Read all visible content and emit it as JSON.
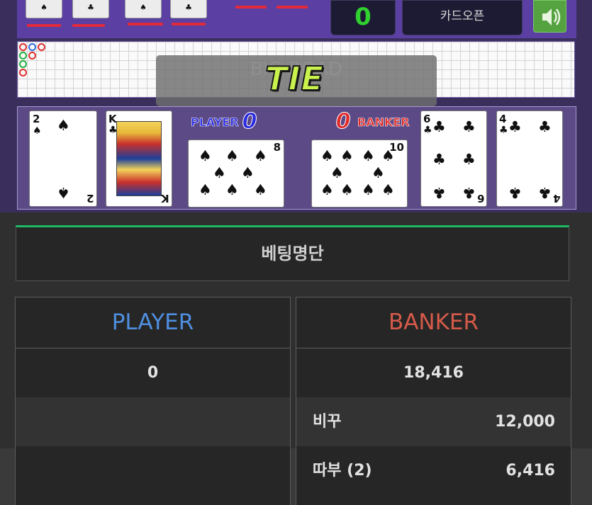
{
  "game": {
    "count_value": "0",
    "card_open_label": "카드오픈",
    "road_label": "BIG ROAD",
    "result_text": "TIE",
    "player_label": "PLAYER",
    "banker_label": "BANKER",
    "player_score": "0",
    "banker_score": "0",
    "road_dot_colors": [
      "#e03030",
      "#2f6fe0",
      "#e03030",
      "#22b040",
      "#e03030",
      "#22b040"
    ],
    "player_cards": [
      {
        "rank": "2",
        "suit": "♠"
      },
      {
        "rank": "K",
        "suit": "♣"
      },
      {
        "rank": "8",
        "suit": "♠"
      }
    ],
    "banker_cards": [
      {
        "rank": "10",
        "suit": "♠"
      },
      {
        "rank": "6",
        "suit": "♣"
      },
      {
        "rank": "4",
        "suit": "♣"
      }
    ],
    "colors": {
      "player": "#2b2be0",
      "banker": "#e02a2a",
      "tie": "#c9f24c"
    }
  },
  "betting": {
    "title": "베팅명단",
    "player": {
      "heading": "PLAYER",
      "total": "0"
    },
    "banker": {
      "heading": "BANKER",
      "total": "18,416",
      "entries": [
        {
          "name": "비꾸",
          "amount": "12,000"
        },
        {
          "name": "따부 (2)",
          "amount": "6,416"
        }
      ]
    },
    "colors": {
      "player_heading": "#4f8fe0",
      "banker_heading": "#d65a4a",
      "accent": "#1ebb66"
    }
  }
}
